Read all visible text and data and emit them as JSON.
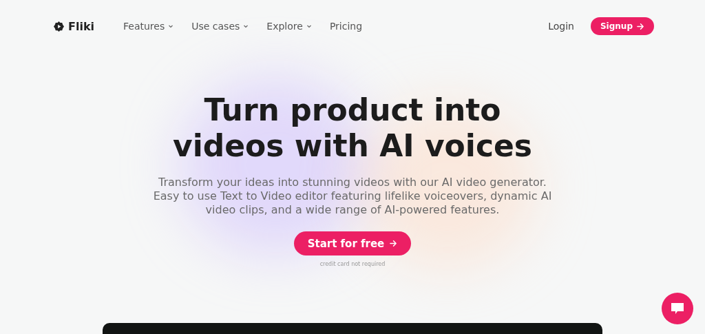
{
  "nav": {
    "logo": "Fliki",
    "items": [
      {
        "label": "Features",
        "dropdown": true
      },
      {
        "label": "Use cases",
        "dropdown": true
      },
      {
        "label": "Explore",
        "dropdown": true
      },
      {
        "label": "Pricing",
        "dropdown": false
      }
    ],
    "login": "Login",
    "signup": "Signup"
  },
  "hero": {
    "title": "Turn product into videos with AI voices",
    "subtitle": "Transform your ideas into stunning videos with our AI video generator. Easy to use Text to Video editor featuring lifelike voiceovers, dynamic AI video clips, and a wide range of AI-powered features.",
    "cta": "Start for free",
    "note": "credit card not required"
  }
}
